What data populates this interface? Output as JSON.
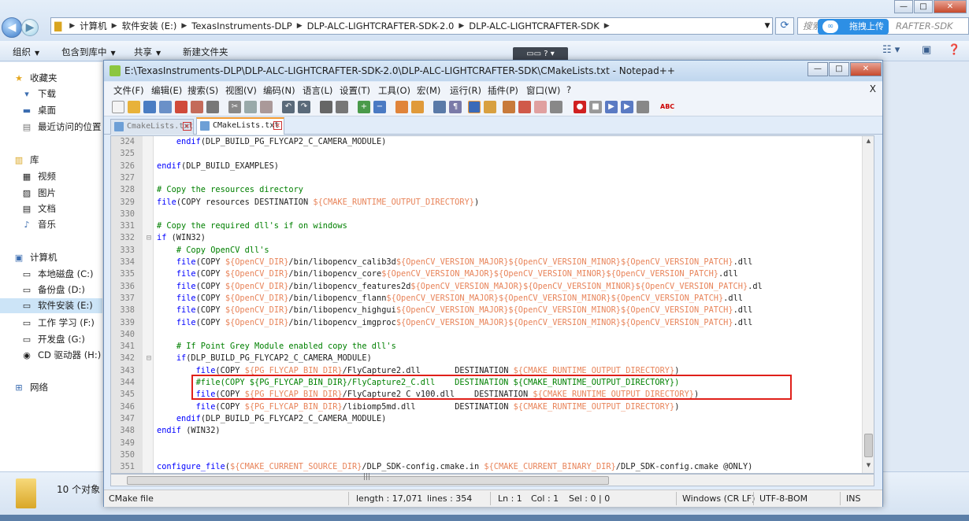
{
  "explorer": {
    "path": [
      "计算机",
      "软件安装 (E:)",
      "TexasInstruments-DLP",
      "DLP-ALC-LIGHTCRAFTER-SDK-2.0",
      "DLP-ALC-LIGHTCRAFTER-SDK"
    ],
    "search_placeholder": "搜索",
    "search_tail": "RAFTER-SDK",
    "upload_label": "拖拽上传",
    "toolbar": {
      "organize": "组织",
      "include": "包含到库中",
      "share": "共享",
      "new_folder": "新建文件夹"
    },
    "sidebar": {
      "favorites": "收藏夹",
      "fav_items": [
        "下载",
        "桌面",
        "最近访问的位置"
      ],
      "libraries": "库",
      "lib_items": [
        "视频",
        "图片",
        "文档",
        "音乐"
      ],
      "computer": "计算机",
      "drives": [
        "本地磁盘 (C:)",
        "备份盘 (D:)",
        "软件安装 (E:)",
        "工作 学习 (F:)",
        "开发盘 (G:)",
        "CD 驱动器 (H:)"
      ],
      "network": "网络"
    },
    "item_count": "10 个对象"
  },
  "notepad": {
    "title": "E:\\TexasInstruments-DLP\\DLP-ALC-LIGHTCRAFTER-SDK-2.0\\DLP-ALC-LIGHTCRAFTER-SDK\\CMakeLists.txt - Notepad++",
    "menu": [
      "文件(F)",
      "编辑(E)",
      "搜索(S)",
      "视图(V)",
      "编码(N)",
      "语言(L)",
      "设置(T)",
      "工具(O)",
      "宏(M)",
      "运行(R)",
      "插件(P)",
      "窗口(W)",
      "?"
    ],
    "menu_close": "X",
    "tabs": [
      "CmakeLists.txt",
      "CMakeLists.txt"
    ],
    "status": {
      "lang": "CMake file",
      "length": "length : 17,071",
      "lines": "lines : 354",
      "ln": "Ln : 1",
      "col": "Col : 1",
      "sel": "Sel : 0 | 0",
      "eol": "Windows (CR LF)",
      "enc": "UTF-8-BOM",
      "ins": "INS"
    }
  },
  "code": [
    {
      "n": "324",
      "f": "",
      "t": [
        [
          "    ",
          ""
        ],
        [
          "endif",
          "kw"
        ],
        [
          "(DLP_BUILD_PG_FLYCAP2_C_CAMERA_MODULE)",
          ""
        ]
      ]
    },
    {
      "n": "325",
      "f": "",
      "t": []
    },
    {
      "n": "326",
      "f": "",
      "t": [
        [
          "endif",
          "kw"
        ],
        [
          "(DLP_BUILD_EXAMPLES)",
          ""
        ]
      ]
    },
    {
      "n": "327",
      "f": "",
      "t": []
    },
    {
      "n": "328",
      "f": "",
      "t": [
        [
          "# Copy the resources directory",
          "cmt"
        ]
      ]
    },
    {
      "n": "329",
      "f": "",
      "t": [
        [
          "file",
          "kw"
        ],
        [
          "(COPY resources DESTINATION ",
          ""
        ],
        [
          "${CMAKE_RUNTIME_OUTPUT_DIRECTORY}",
          "var"
        ],
        [
          ")",
          ""
        ]
      ]
    },
    {
      "n": "330",
      "f": "",
      "t": []
    },
    {
      "n": "331",
      "f": "",
      "t": [
        [
          "# Copy the required dll's if on windows",
          "cmt"
        ]
      ]
    },
    {
      "n": "332",
      "f": "⊟",
      "t": [
        [
          "if",
          "kw"
        ],
        [
          " (WIN32)",
          ""
        ]
      ]
    },
    {
      "n": "333",
      "f": "",
      "t": [
        [
          "    ",
          ""
        ],
        [
          "# Copy OpenCV dll's",
          "cmt"
        ]
      ]
    },
    {
      "n": "334",
      "f": "",
      "t": [
        [
          "    ",
          ""
        ],
        [
          "file",
          "kw"
        ],
        [
          "(COPY ",
          ""
        ],
        [
          "${OpenCV_DIR}",
          "var"
        ],
        [
          "/bin/libopencv_calib3d",
          ""
        ],
        [
          "${OpenCV_VERSION_MAJOR}${OpenCV_VERSION_MINOR}${OpenCV_VERSION_PATCH}",
          "var"
        ],
        [
          ".dll",
          ""
        ]
      ]
    },
    {
      "n": "335",
      "f": "",
      "t": [
        [
          "    ",
          ""
        ],
        [
          "file",
          "kw"
        ],
        [
          "(COPY ",
          ""
        ],
        [
          "${OpenCV_DIR}",
          "var"
        ],
        [
          "/bin/libopencv_core",
          ""
        ],
        [
          "${OpenCV_VERSION_MAJOR}${OpenCV_VERSION_MINOR}${OpenCV_VERSION_PATCH}",
          "var"
        ],
        [
          ".dll",
          ""
        ]
      ]
    },
    {
      "n": "336",
      "f": "",
      "t": [
        [
          "    ",
          ""
        ],
        [
          "file",
          "kw"
        ],
        [
          "(COPY ",
          ""
        ],
        [
          "${OpenCV_DIR}",
          "var"
        ],
        [
          "/bin/libopencv_features2d",
          ""
        ],
        [
          "${OpenCV_VERSION_MAJOR}${OpenCV_VERSION_MINOR}${OpenCV_VERSION_PATCH}",
          "var"
        ],
        [
          ".dl",
          ""
        ]
      ]
    },
    {
      "n": "337",
      "f": "",
      "t": [
        [
          "    ",
          ""
        ],
        [
          "file",
          "kw"
        ],
        [
          "(COPY ",
          ""
        ],
        [
          "${OpenCV_DIR}",
          "var"
        ],
        [
          "/bin/libopencv_flann",
          ""
        ],
        [
          "${OpenCV_VERSION_MAJOR}${OpenCV_VERSION_MINOR}${OpenCV_VERSION_PATCH}",
          "var"
        ],
        [
          ".dll",
          ""
        ]
      ]
    },
    {
      "n": "338",
      "f": "",
      "t": [
        [
          "    ",
          ""
        ],
        [
          "file",
          "kw"
        ],
        [
          "(COPY ",
          ""
        ],
        [
          "${OpenCV_DIR}",
          "var"
        ],
        [
          "/bin/libopencv_highgui",
          ""
        ],
        [
          "${OpenCV_VERSION_MAJOR}${OpenCV_VERSION_MINOR}${OpenCV_VERSION_PATCH}",
          "var"
        ],
        [
          ".dll",
          ""
        ]
      ]
    },
    {
      "n": "339",
      "f": "",
      "t": [
        [
          "    ",
          ""
        ],
        [
          "file",
          "kw"
        ],
        [
          "(COPY ",
          ""
        ],
        [
          "${OpenCV_DIR}",
          "var"
        ],
        [
          "/bin/libopencv_imgproc",
          ""
        ],
        [
          "${OpenCV_VERSION_MAJOR}${OpenCV_VERSION_MINOR}${OpenCV_VERSION_PATCH}",
          "var"
        ],
        [
          ".dll",
          ""
        ]
      ]
    },
    {
      "n": "340",
      "f": "",
      "t": []
    },
    {
      "n": "341",
      "f": "",
      "t": [
        [
          "    ",
          ""
        ],
        [
          "# If Point Grey Module enabled copy the dll's",
          "cmt"
        ]
      ]
    },
    {
      "n": "342",
      "f": "⊟",
      "t": [
        [
          "    ",
          ""
        ],
        [
          "if",
          "kw"
        ],
        [
          "(DLP_BUILD_PG_FLYCAP2_C_CAMERA_MODULE)",
          ""
        ]
      ]
    },
    {
      "n": "343",
      "f": "",
      "t": [
        [
          "        ",
          ""
        ],
        [
          "file",
          "kw"
        ],
        [
          "(COPY ",
          ""
        ],
        [
          "${PG_FLYCAP_BIN_DIR}",
          "var"
        ],
        [
          "/FlyCapture2.dll       DESTINATION ",
          ""
        ],
        [
          "${CMAKE_RUNTIME_OUTPUT_DIRECTORY}",
          "var"
        ],
        [
          ")",
          ""
        ]
      ]
    },
    {
      "n": "344",
      "f": "",
      "t": [
        [
          "        ",
          ""
        ],
        [
          "#file(COPY ${PG_FLYCAP_BIN_DIR}/FlyCapture2_C.dll    DESTINATION ${CMAKE_RUNTIME_OUTPUT_DIRECTORY})",
          "cmt"
        ]
      ]
    },
    {
      "n": "345",
      "f": "",
      "t": [
        [
          "        ",
          ""
        ],
        [
          "file",
          "kw"
        ],
        [
          "(COPY ",
          ""
        ],
        [
          "${PG_FLYCAP_BIN_DIR}",
          "var"
        ],
        [
          "/FlyCapture2_C_v100.dll    DESTINATION ",
          ""
        ],
        [
          "${CMAKE_RUNTIME_OUTPUT_DIRECTORY}",
          "var"
        ],
        [
          ")",
          ""
        ]
      ]
    },
    {
      "n": "346",
      "f": "",
      "t": [
        [
          "        ",
          ""
        ],
        [
          "file",
          "kw"
        ],
        [
          "(COPY ",
          ""
        ],
        [
          "${PG_FLYCAP_BIN_DIR}",
          "var"
        ],
        [
          "/libiomp5md.dll        DESTINATION ",
          ""
        ],
        [
          "${CMAKE_RUNTIME_OUTPUT_DIRECTORY}",
          "var"
        ],
        [
          ")",
          ""
        ]
      ]
    },
    {
      "n": "347",
      "f": "",
      "t": [
        [
          "    ",
          ""
        ],
        [
          "endif",
          "kw"
        ],
        [
          "(DLP_BUILD_PG_FLYCAP2_C_CAMERA_MODULE)",
          ""
        ]
      ]
    },
    {
      "n": "348",
      "f": "",
      "t": [
        [
          "endif",
          "kw"
        ],
        [
          " (WIN32)",
          ""
        ]
      ]
    },
    {
      "n": "349",
      "f": "",
      "t": []
    },
    {
      "n": "350",
      "f": "",
      "t": []
    },
    {
      "n": "351",
      "f": "",
      "t": [
        [
          "configure_file",
          "kw"
        ],
        [
          "(",
          ""
        ],
        [
          "${CMAKE_CURRENT_SOURCE_DIR}",
          "var"
        ],
        [
          "/DLP_SDK-config.cmake.in ",
          ""
        ],
        [
          "${CMAKE_CURRENT_BINARY_DIR}",
          "var"
        ],
        [
          "/DLP_SDK-config.cmake @ONLY)",
          ""
        ]
      ]
    }
  ]
}
